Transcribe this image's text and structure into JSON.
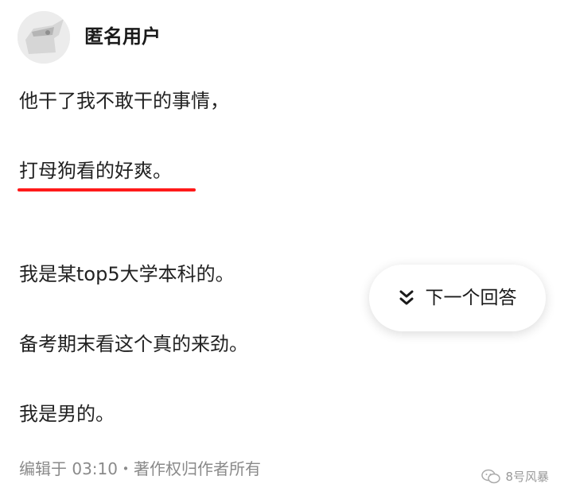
{
  "author": {
    "name": "匿名用户"
  },
  "answer": {
    "paragraphs": [
      "他干了我不敢干的事情，",
      "打母狗看的好爽。",
      "我是某top5大学本科的。",
      "备考期末看这个真的来劲。",
      "我是男的。"
    ],
    "highlight_color": "#ff1a1a"
  },
  "next_answer": {
    "label": "下一个回答",
    "icon": "chevron-double-down-icon"
  },
  "meta": {
    "edited": "编辑于 03:10・著作权归作者所有"
  },
  "watermark": {
    "text": "8号风暴",
    "icon": "wechat-icon"
  }
}
